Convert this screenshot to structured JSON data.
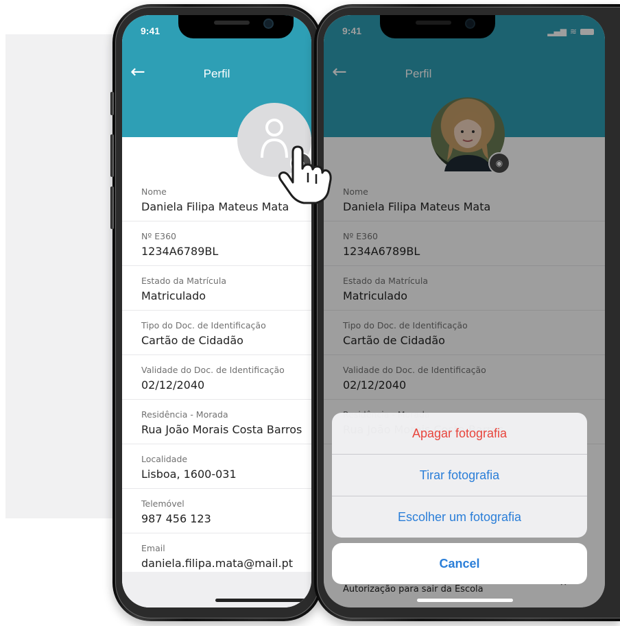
{
  "status_bar": {
    "time": "9:41"
  },
  "header": {
    "title": "Perfil",
    "back_icon": "arrow-left-icon"
  },
  "profile": {
    "fields": [
      {
        "label": "Nome",
        "value": "Daniela Filipa Mateus Mata"
      },
      {
        "label": "Nº E360",
        "value": "1234A6789BL"
      },
      {
        "label": "Estado da Matrícula",
        "value": "Matriculado"
      },
      {
        "label": "Tipo do Doc. de Identificação",
        "value": "Cartão de Cidadão"
      },
      {
        "label": "Validade do Doc. de Identificação",
        "value": "02/12/2040"
      },
      {
        "label": "Residência - Morada",
        "value": "Rua João Morais Costa Barros"
      },
      {
        "label": "Localidade",
        "value": "Lisboa, 1600-031"
      },
      {
        "label": "Telemóvel",
        "value": "987 456 123"
      },
      {
        "label": "Email",
        "value": "daniela.filipa.mata@mail.pt"
      }
    ],
    "last_row_label": "Autorização para sair da Escola"
  },
  "action_sheet": {
    "delete": "Apagar fotografia",
    "take": "Tirar fotografia",
    "choose": "Escolher um fotografia",
    "cancel": "Cancel"
  },
  "colors": {
    "header": "#2e9fb5",
    "action_blue": "#2a7ed8",
    "action_red": "#e8453c"
  }
}
